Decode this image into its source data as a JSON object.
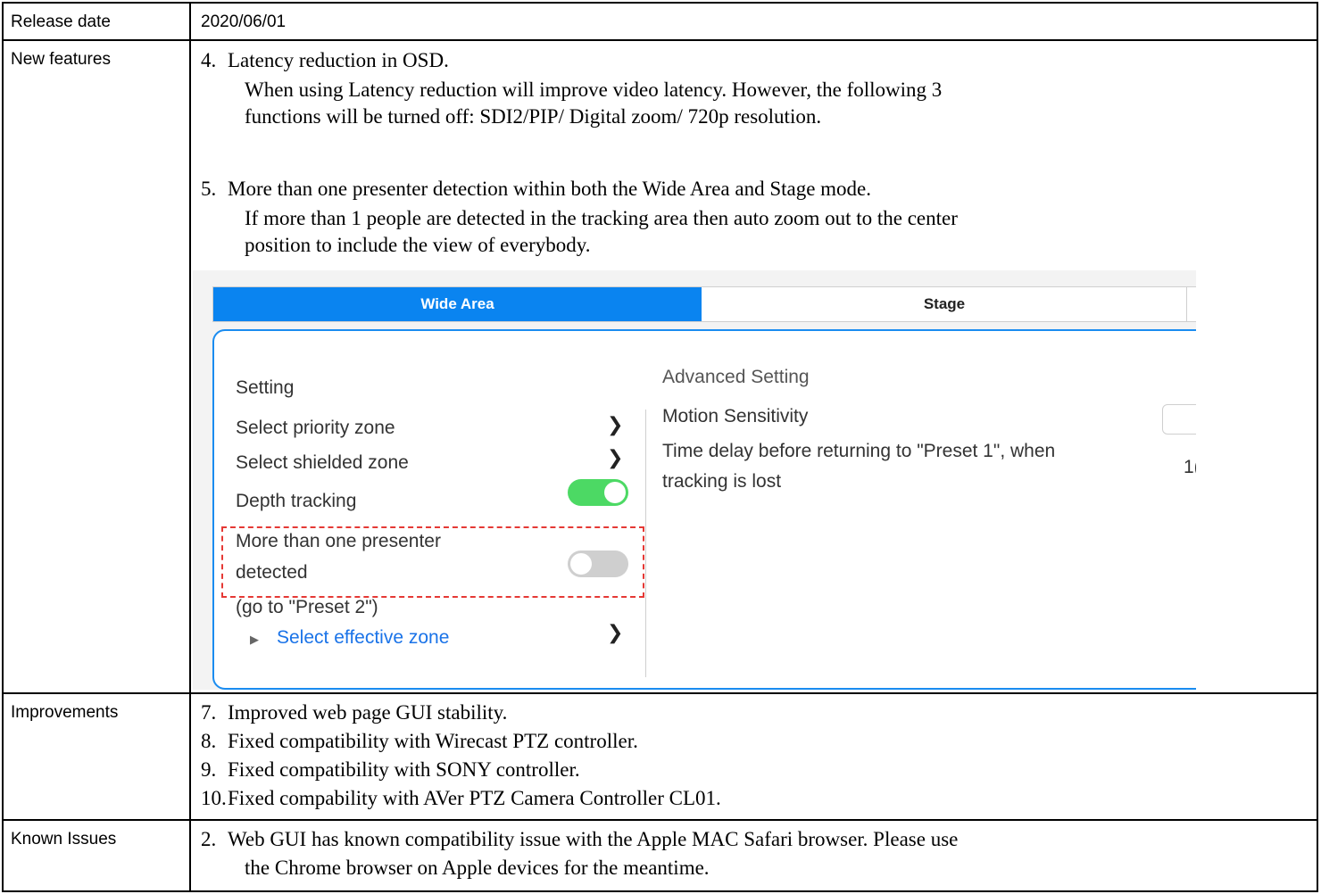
{
  "rows": {
    "release": {
      "label": "Release date",
      "value": "2020/06/01"
    },
    "features": {
      "label": "New features",
      "items": [
        {
          "num": "4.",
          "title": "Latency reduction in OSD.",
          "lines": [
            "When using Latency reduction will improve video latency.  However, the following 3",
            "functions will be turned off: SDI2/PIP/ Digital zoom/ 720p resolution."
          ]
        },
        {
          "num": "5.",
          "title": "More than one presenter detection within both the Wide Area and Stage mode.",
          "lines": [
            "If more than 1 people are detected in the tracking area then auto zoom out to the center",
            "position to include the view of everybody."
          ]
        }
      ]
    },
    "improvements": {
      "label": "Improvements",
      "items": [
        {
          "num": "7.",
          "text": "Improved web page GUI stability."
        },
        {
          "num": "8.",
          "text": "Fixed compatibility with Wirecast PTZ controller."
        },
        {
          "num": "9.",
          "text": "Fixed compatibility with SONY controller."
        },
        {
          "num": "10.",
          "text": "Fixed compability with AVer PTZ Camera Controller CL01."
        }
      ]
    },
    "known": {
      "label": "Known Issues",
      "num": "2.",
      "lines": [
        "Web GUI has known compatibility issue with the Apple MAC Safari browser.  Please use",
        "the Chrome browser on Apple devices for the meantime."
      ]
    }
  },
  "screenshot": {
    "tabs": [
      "Wide Area",
      "Stage"
    ],
    "active_tab": "Wide Area",
    "accent_color": "#0a84f0",
    "setting_title": "Setting",
    "select_priority_zone": "Select priority zone",
    "select_shielded_zone": "Select shielded zone",
    "depth_tracking": "Depth tracking",
    "depth_tracking_on": true,
    "more_presenter_line1": "More than one presenter",
    "more_presenter_line2": "detected",
    "more_presenter_on": false,
    "goto_preset": "(go to \"Preset 2\")",
    "select_effective_zone": "Select effective zone",
    "advanced_title": "Advanced Setting",
    "motion_sensitivity": "Motion Sensitivity",
    "time_delay_line1": "Time delay before returning to \"Preset 1\", when",
    "time_delay_line2": "tracking is lost",
    "time_delay_value": "1("
  }
}
